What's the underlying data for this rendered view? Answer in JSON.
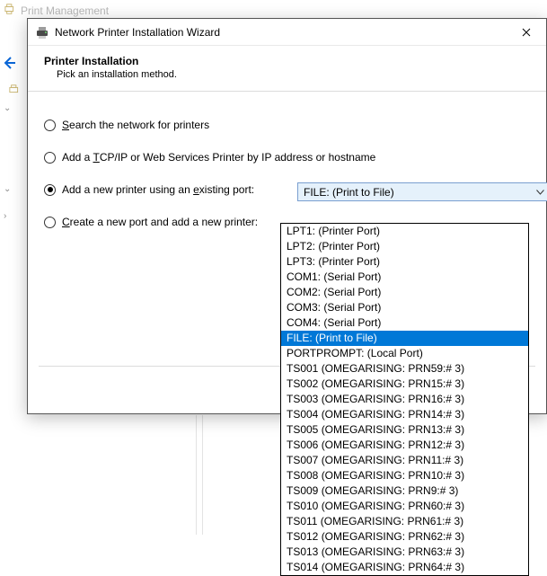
{
  "background": {
    "window_title": "Print Management"
  },
  "dialog": {
    "title": "Network Printer Installation Wizard",
    "header_title": "Printer Installation",
    "header_subtitle": "Pick an installation method.",
    "options": {
      "search": {
        "pre": "",
        "ul": "S",
        "post": "earch the network for printers"
      },
      "tcpip": {
        "pre": "Add a ",
        "ul": "T",
        "post": "CP/IP or Web Services Printer by IP address or hostname"
      },
      "existing": {
        "pre": "Add a new printer using an ",
        "ul": "e",
        "post": "xisting port:"
      },
      "newport": {
        "pre": "",
        "ul": "C",
        "post": "reate a new port and add a new printer:"
      }
    },
    "selected_radio": "existing",
    "combo_value": "FILE: (Print to File)"
  },
  "dropdown": {
    "selected_index": 7,
    "items": [
      "LPT1: (Printer Port)",
      "LPT2: (Printer Port)",
      "LPT3: (Printer Port)",
      "COM1: (Serial Port)",
      "COM2: (Serial Port)",
      "COM3: (Serial Port)",
      "COM4: (Serial Port)",
      "FILE: (Print to File)",
      "PORTPROMPT: (Local Port)",
      "TS001 (OMEGARISING:  PRN59:# 3)",
      "TS002 (OMEGARISING:  PRN15:# 3)",
      "TS003 (OMEGARISING:  PRN16:# 3)",
      "TS004 (OMEGARISING:  PRN14:# 3)",
      "TS005 (OMEGARISING:  PRN13:# 3)",
      "TS006 (OMEGARISING:  PRN12:# 3)",
      "TS007 (OMEGARISING:  PRN11:# 3)",
      "TS008 (OMEGARISING:  PRN10:# 3)",
      "TS009 (OMEGARISING:  PRN9:# 3)",
      "TS010 (OMEGARISING:  PRN60:# 3)",
      "TS011 (OMEGARISING:  PRN61:# 3)",
      "TS012 (OMEGARISING:  PRN62:# 3)",
      "TS013 (OMEGARISING:  PRN63:# 3)",
      "TS014 (OMEGARISING:  PRN64:# 3)"
    ]
  }
}
